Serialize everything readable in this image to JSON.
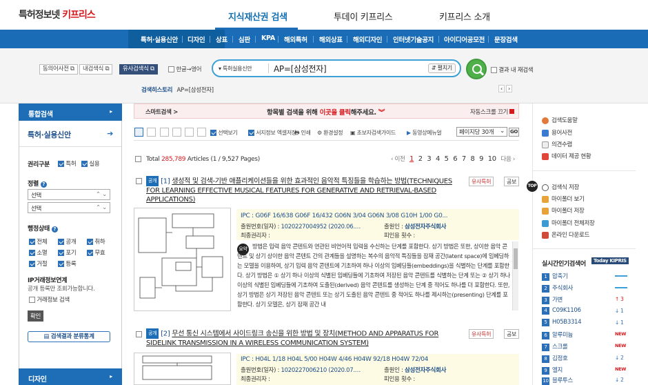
{
  "header": {
    "logo_prefix": "특허정보넷",
    "logo_brand": "키프리스",
    "nav": [
      "지식재산권 검색",
      "투데이 키프리스",
      "키프리스 소개"
    ]
  },
  "menubar": {
    "items": [
      "특허·실용신안",
      "디자인",
      "상표",
      "심판",
      "KPA",
      "해외특허",
      "해외상표",
      "해외디자인",
      "인터넷기술공지",
      "아이디어공모전",
      "문장검색"
    ]
  },
  "search": {
    "buttons": [
      "동의어사전",
      "내검색식",
      "유사검색식",
      "한글→영어"
    ],
    "category": "특허실용신안",
    "query": "AP=[삼성전자]",
    "expand_label": "펼치기",
    "within_label": "결과 내 재검색",
    "history_label": "검색히스토리",
    "history_value": "AP=[삼성전자]"
  },
  "sidebar": {
    "head": "통합검색",
    "sub": "특허·실용신안",
    "rights_label": "권리구분",
    "rights": [
      "특허",
      "실용"
    ],
    "sort_label": "정렬",
    "sort_selects": [
      "선택",
      "선택"
    ],
    "status_label": "행정상태",
    "statuses": [
      "전체",
      "공개",
      "취하",
      "소멸",
      "포기",
      "무효",
      "거절",
      "등록"
    ],
    "ip_label": "IP거래정보연계",
    "ip_desc": "공개 등록만 조회가능합니다.",
    "ip_check": "거래정보 검색",
    "confirm": "확인",
    "stats_btn": "검색결과 분류통계",
    "bottom": "디자인"
  },
  "main": {
    "smart_label": "스마트검색 >",
    "smart_msg_a": "항목별 검색을 위해",
    "smart_msg_b": "이곳을 클릭",
    "smart_msg_c": "해주세요.",
    "autoscroll": "자동스크롤 끄기",
    "tools": [
      "선택보기",
      "서지정보 엑셀저장",
      "인쇄",
      "환경설정",
      "초보자검색가이드",
      "동영상메뉴얼"
    ],
    "per_page": "페이지당 30개",
    "go": "GO",
    "total_prefix": "Total",
    "total_count": "285,789",
    "total_suffix": "Articles (1 / 9,527 Pages)",
    "prev": "‹ 이전",
    "pages": [
      "1",
      "2",
      "3",
      "4",
      "5",
      "6",
      "7",
      "8",
      "9",
      "10"
    ],
    "next": "다음 ›",
    "results": [
      {
        "badge": "공개",
        "num": "[1]",
        "title": "생성적 및 검색-기반 애플리케이션들을 위한 효과적인 음악적 특징들을 학습하는 방법(TECHNIQUES FOR LEARNING EFFECTIVE MUSICAL FEATURES FOR GENERATIVE AND RETRIEVAL-BASED APPLICATIONS)",
        "tags": [
          "유사특허",
          "공보"
        ],
        "ipc": "IPC : G06F 16/638    G06F 16/432    G06N 3/04    G06N 3/08    G10H 1/00    G0...",
        "appno_label": "출원번호(일자) :",
        "appno": "1020227004952 (2020.06.…",
        "applicant_label": "출원인 :",
        "applicant": "삼성전자주식회사",
        "holder_label": "최종권리자 :",
        "cited_label": "피인용 횟수 :",
        "summary_badge": "요약",
        "abstract": "방법은 입력 음악 콘텐트와 연관된 비언어적 입력을 수신하는 단계를 포함한다. 상기 방법은 또한, 상이한 음악 콘텐트 및 상기 상이한 음악 콘텐트 간의 관계들을 설명하는 복수의 음악적 특징들을 잠재 공간(latent space)에 임베딩하는 모델을 이용하여, 상기 입력 음악 콘텐트에 기초하여 하나 이상의 임베딩들(embeddings)을 식별하는 단계를 포함한다. 상기 방법은 ① 상기 하나 이상의 식별된 임베딩들에 기초하여 저장된 음악 콘텐트를 식별하는 단계 또는 ② 상기 하나 이상의 식별된 임베딩들에 기초하여 도출된(derived) 음악 콘텐트를 생성하는 단계 중 적어도 하나를 더 포함한다. 또한, 상기 방법은 상기 저장된 음악 콘텐트 또는 상기 도출된 음악 콘텐트 중 적어도 하나를 제시하는(presenting) 단계를 포함한다. 상기 모델은, 상기 잠재 공간 내"
      },
      {
        "badge": "공개",
        "num": "[2]",
        "title": "무선 통신 시스템에서 사이드링크 송신을 위한 방법 및 장치(METHOD AND APPARATUS FOR SIDELINK TRANSMISSION IN A WIRELESS COMMUNICATION SYSTEM)",
        "tags": [
          "유사특허",
          "공보"
        ],
        "ipc": "IPC : H04L 1/18    H04L 5/00    H04W 4/46    H04W 92/18    H04W 72/04",
        "appno_label": "출원번호(일자) :",
        "appno": "1020227006210 (2020.07.…",
        "applicant_label": "출원인 :",
        "applicant": "삼성전자주식회사",
        "holder_label": "최종권리자 :",
        "cited_label": "피인용 횟수 :"
      }
    ]
  },
  "right": {
    "links1": [
      "검색도움말",
      "용어사전",
      "의견수렴",
      "데이터 제공 현황"
    ],
    "top_badge": "TOP",
    "links2": [
      "검색식 저장",
      "마이폴더 보기",
      "마이폴더 저장",
      "마이폴더 전체저장",
      "온라인 다운로드"
    ],
    "ranking_title": "실시간인기검색어",
    "today_badge": "Today KIPRIS",
    "ranking": [
      {
        "n": "1",
        "t": "압축기",
        "c": "—"
      },
      {
        "n": "2",
        "t": "주식회사",
        "c": "—"
      },
      {
        "n": "3",
        "t": "가변",
        "c": "↑ 3"
      },
      {
        "n": "4",
        "t": "C09K1106",
        "c": "↓ 1"
      },
      {
        "n": "5",
        "t": "H05B3314",
        "c": "↓ 1"
      },
      {
        "n": "6",
        "t": "알루미늄",
        "c": "NEW"
      },
      {
        "n": "7",
        "t": "스크롤",
        "c": "NEW"
      },
      {
        "n": "8",
        "t": "김정호",
        "c": "↓ 2"
      },
      {
        "n": "9",
        "t": "엘지",
        "c": "NEW"
      },
      {
        "n": "10",
        "t": "블루투스",
        "c": "↓ 2"
      }
    ]
  },
  "colors": {
    "brand_red": "#d6181d",
    "primary_blue": "#1d6eb7",
    "go_green": "#4fb04a",
    "total_red": "#d6181d"
  }
}
